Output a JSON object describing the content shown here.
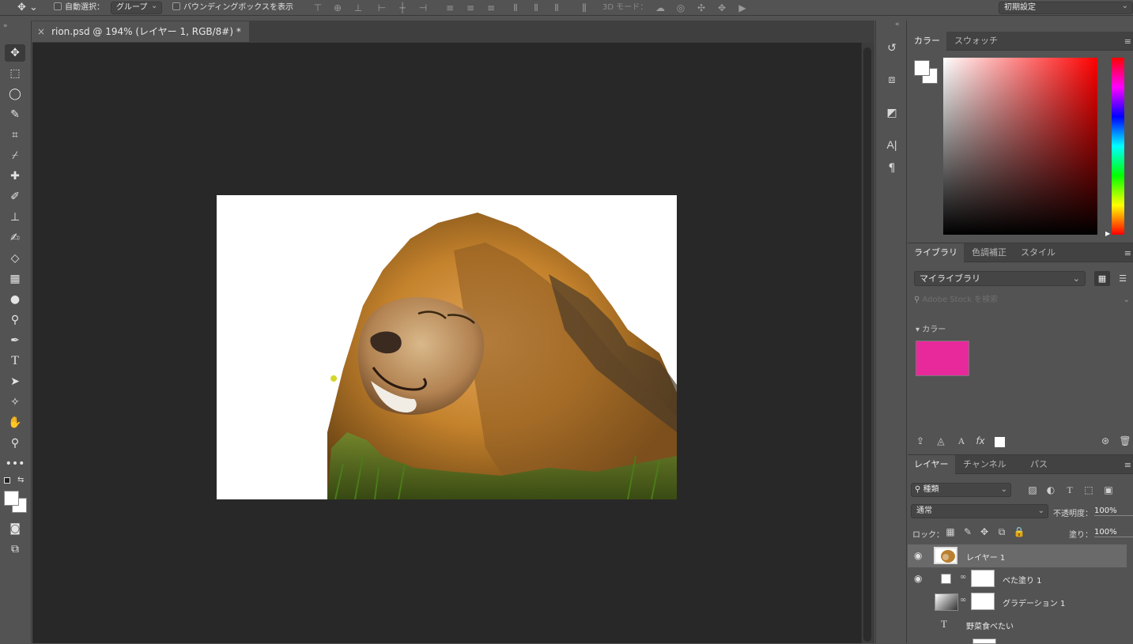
{
  "options_bar": {
    "auto_select_label": "自動選択：",
    "auto_select_value": "グループ",
    "bounding_box_label": "バウンディングボックスを表示",
    "mode_3d_label": "3D モード：",
    "workspace_value": "初期設定"
  },
  "document": {
    "tab_title": "rion.psd @ 194% (レイヤー 1, RGB/8#) *",
    "close_glyph": "×"
  },
  "color_panel": {
    "tabs": [
      "カラー",
      "スウォッチ"
    ],
    "active_tab": 0
  },
  "library_panel": {
    "tabs": [
      "ライブラリ",
      "色調補正",
      "スタイル"
    ],
    "library_select": "マイライブラリ",
    "search_placeholder": "Adobe Stock を検索",
    "section_label": "カラー",
    "swatch_color": "#e8299b"
  },
  "layers_panel": {
    "tabs": [
      "レイヤー",
      "チャンネル",
      "パス"
    ],
    "filter_value": "種類",
    "blend_mode": "通常",
    "opacity_label": "不透明度：",
    "opacity_value": "100%",
    "lock_label": "ロック：",
    "fill_label": "塗り：",
    "fill_value": "100%",
    "layers": [
      {
        "name": "レイヤー 1",
        "visible": true,
        "selected": true,
        "kind": "pixel"
      },
      {
        "name": "べた塗り 1",
        "visible": true,
        "selected": false,
        "kind": "fill"
      },
      {
        "name": "グラデーション 1",
        "visible": false,
        "selected": false,
        "kind": "gradient"
      },
      {
        "name": "野菜食べたい",
        "visible": false,
        "selected": false,
        "kind": "text"
      }
    ]
  },
  "colors": {
    "canvas_bg": "#282828",
    "ui_bg": "#535353",
    "foreground": "#ffffff",
    "background": "#ffffff"
  },
  "icons": {
    "text_layer_glyph": "T",
    "eye_glyph": "👁",
    "link_glyph": "⛓",
    "panel_menu_glyph": "≡"
  }
}
